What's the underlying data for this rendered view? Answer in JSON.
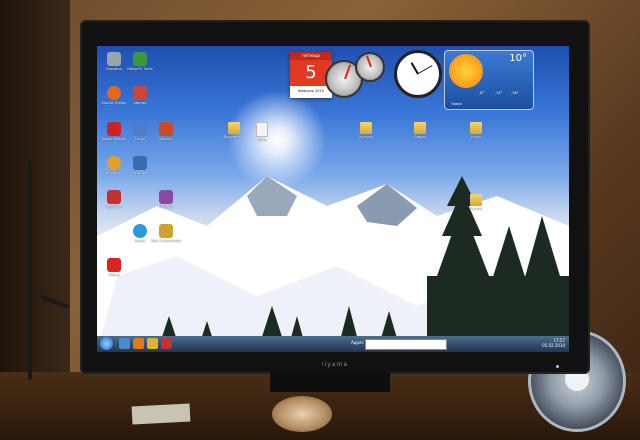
{
  "monitor": {
    "brand": "iiyama"
  },
  "calendar": {
    "header": "пятница",
    "day": "5",
    "footer": "Февраль 2010"
  },
  "weather": {
    "temperature": "10°",
    "city": "Томск",
    "forecast": [
      "-8°",
      "-12°",
      "-16°"
    ]
  },
  "desktop_icons_left": [
    {
      "label": "Корзина",
      "color": "#9aa4ae"
    },
    {
      "label": "Nokia PC Suite",
      "color": "#3a9a3a"
    },
    {
      "label": "Mozilla Firefox",
      "color": "#e06a1a"
    },
    {
      "label": "Аватар",
      "color": "#c8463a"
    },
    {
      "label": "Adobe Reader",
      "color": "#cc2222"
    },
    {
      "label": "BitComet",
      "color": "#e0a02a"
    },
    {
      "label": "Daemon",
      "color": "#c23030"
    },
    {
      "label": "Opera",
      "color": "#dd2222"
    }
  ],
  "desktop_icons_right": [
    {
      "label": "Тотал",
      "color": "#4a7ec8"
    },
    {
      "label": "ACDSee",
      "color": "#3a6ab0"
    },
    {
      "label": "Мастер",
      "color": "#c84a2a"
    },
    {
      "label": "WinRAR",
      "color": "#8a4aa0"
    },
    {
      "label": "Skype",
      "color": "#2a9ad8"
    },
    {
      "label": "Total Commander",
      "color": "#d0a030"
    }
  ],
  "folders": [
    {
      "label": "Документы"
    },
    {
      "label": "Фото"
    },
    {
      "label": "Музыка"
    },
    {
      "label": "Видео"
    },
    {
      "label": "Игры"
    },
    {
      "label": "Разное"
    }
  ],
  "taskbar": {
    "address_label": "Адрес",
    "time": "17:57",
    "date": "05.02.2010"
  }
}
